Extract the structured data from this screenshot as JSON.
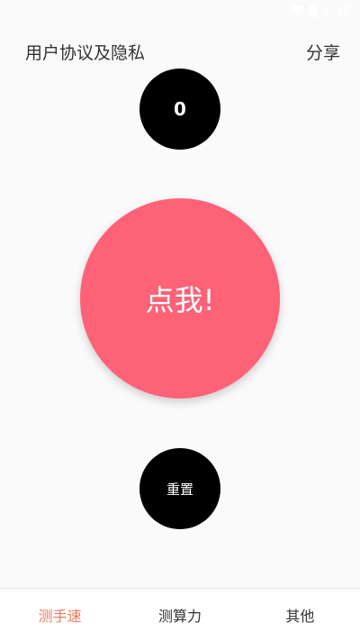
{
  "status_bar": {
    "time": "8:18",
    "wifi_icon": "wifi-icon",
    "battery_icon": "battery-icon"
  },
  "header": {
    "privacy_label": "用户协议及隐私",
    "share_label": "分享"
  },
  "counter": {
    "value": "0"
  },
  "tap_button": {
    "label": "点我!",
    "color": "#fd6277"
  },
  "reset_button": {
    "label": "重置"
  },
  "bottom_nav": {
    "active_color": "#f07a5a",
    "items": [
      {
        "label": "测手速",
        "active": true
      },
      {
        "label": "测算力",
        "active": false
      },
      {
        "label": "其他",
        "active": false
      }
    ]
  }
}
